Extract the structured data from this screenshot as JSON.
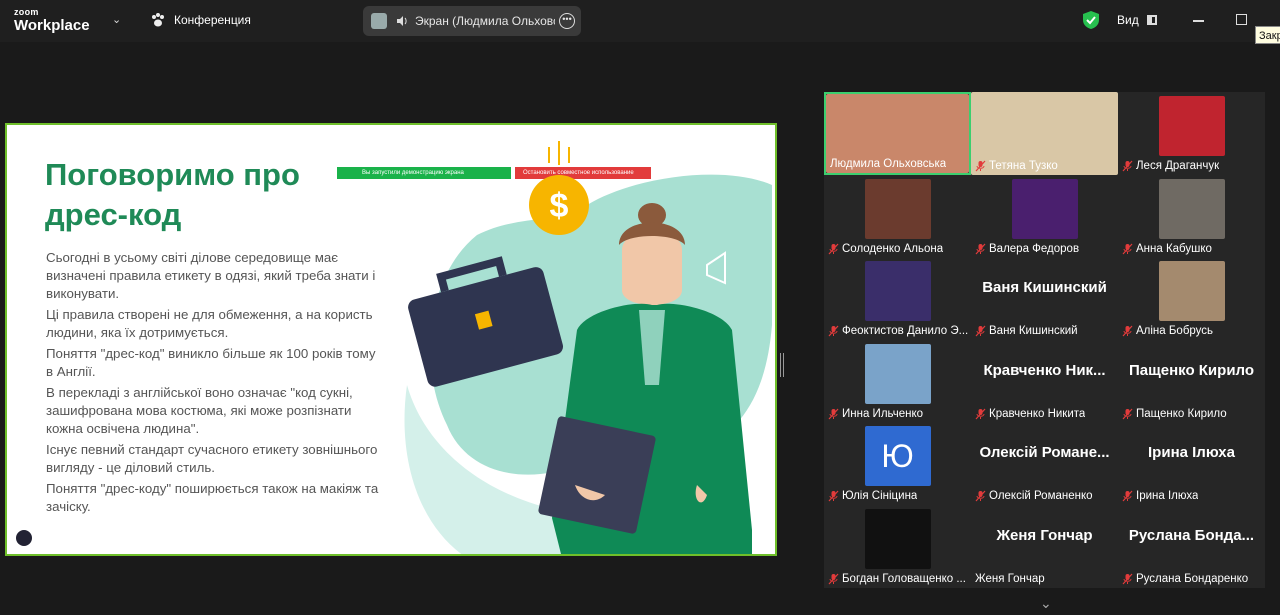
{
  "app": {
    "logo_line1": "zoom",
    "logo_line2": "Workplace"
  },
  "topbar": {
    "meeting_label": "Конференция",
    "share_label": "Экран (Людмила Ольховська)",
    "view_label": "Вид",
    "tooltip": "Закр"
  },
  "slide": {
    "title": "Поговоримо про дрес-код",
    "paragraphs": [
      "Сьогодні в усьому світі ділове середовище має визначені правила етикету в одязі, який треба знати і виконувати.",
      "Ці правила створені не для обмеження, а на користь людини, яка їх дотримується.",
      "Поняття \"дрес-код\" виникло більше як 100 років тому в Англії.",
      "В перекладі з англійської воно означає \"код сукні, зашифрована мова костюма, які може розпізнати кожна освічена людина\".",
      "Існує певний стандарт сучасного етикету зовнішнього вигляду - це діловий стиль.",
      "Поняття \"дрес-коду\" поширюється також на макіяж та зачіску."
    ],
    "share_bar_text": "Вы запустили демонстрацию экрана",
    "stop_text": "Остановить совместное использование",
    "icon_symbol": "$"
  },
  "participants": [
    {
      "name": "Людмила Ольховська",
      "muted": false,
      "video": true,
      "active": true,
      "bg": "#c9876a"
    },
    {
      "name": "Тетяна Тузко",
      "muted": true,
      "video": true,
      "bg": "#d9c7a6"
    },
    {
      "name": "Леся Драганчук",
      "muted": true,
      "video": true,
      "bg": "#c0242f"
    },
    {
      "name": "Солоденко Альона",
      "muted": true,
      "video": true,
      "bg": "#6b3b2e"
    },
    {
      "name": "Валера Федоров",
      "muted": true,
      "video": true,
      "bg": "#4a1f6e"
    },
    {
      "name": "Анна Кабушко",
      "muted": true,
      "video": true,
      "bg": "#6f6a63"
    },
    {
      "name": "Феоктистов Данило Э...",
      "muted": true,
      "video": true,
      "bg": "#3a2e6a"
    },
    {
      "name": "Ваня Кишинский",
      "muted": true,
      "video": false,
      "big": "Ваня Кишинский"
    },
    {
      "name": "Аліна Бобрусь",
      "muted": true,
      "video": true,
      "bg": "#a48a6e"
    },
    {
      "name": "Инна Ильченко",
      "muted": true,
      "video": true,
      "bg": "#7aa3c9"
    },
    {
      "name": "Кравченко Никита",
      "muted": true,
      "video": false,
      "big": "Кравченко Ник..."
    },
    {
      "name": "Пащенко Кирило",
      "muted": true,
      "video": false,
      "big": "Пащенко Кирило"
    },
    {
      "name": "Юлія Сініцина",
      "muted": true,
      "video": true,
      "bg": "#2f6ad1",
      "letter": "Ю"
    },
    {
      "name": "Олексій Романенко",
      "muted": true,
      "video": false,
      "big": "Олексій Романе..."
    },
    {
      "name": "Ірина Ілюха",
      "muted": true,
      "video": false,
      "big": "Ірина Ілюха"
    },
    {
      "name": "Богдан Головащенко ...",
      "muted": true,
      "video": true,
      "bg": "#111111"
    },
    {
      "name": "Женя Гончар",
      "muted": false,
      "video": false,
      "big": "Женя Гончар"
    },
    {
      "name": "Руслана Бондаренко",
      "muted": true,
      "video": false,
      "big": "Руслана Бонда..."
    }
  ]
}
